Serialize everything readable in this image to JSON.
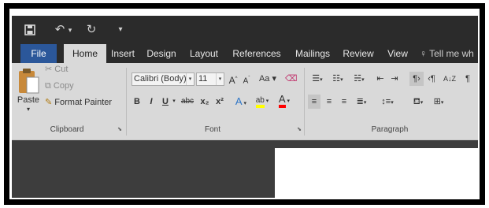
{
  "quick_access": {
    "save_icon": "save-icon",
    "undo_icon": "undo-icon",
    "undo_dropdown": "▾",
    "redo_icon": "redo-icon",
    "customize": "▾"
  },
  "tabs": [
    "File",
    "Home",
    "Insert",
    "Design",
    "Layout",
    "References",
    "Mailings",
    "Review",
    "View"
  ],
  "tell_me": "Tell me wh",
  "clipboard": {
    "paste": "Paste",
    "cut": "Cut",
    "copy": "Copy",
    "format_painter": "Format Painter",
    "group_label": "Clipboard"
  },
  "font": {
    "name": "Calibri (Body)",
    "size": "11",
    "grow": "A",
    "shrink": "A",
    "change_case": "Aa",
    "bold": "B",
    "italic": "I",
    "underline": "U",
    "strikethrough": "abc",
    "subscript": "x₂",
    "superscript": "x²",
    "text_effects": "A",
    "highlight": "ab",
    "font_color": "A",
    "group_label": "Font"
  },
  "paragraph": {
    "sort": "A↓Z",
    "show_marks": "¶",
    "group_label": "Paragraph"
  },
  "colors": {
    "file_tab": "#2b579a",
    "highlight_yellow": "#ffff00",
    "font_red": "#ff0000"
  }
}
